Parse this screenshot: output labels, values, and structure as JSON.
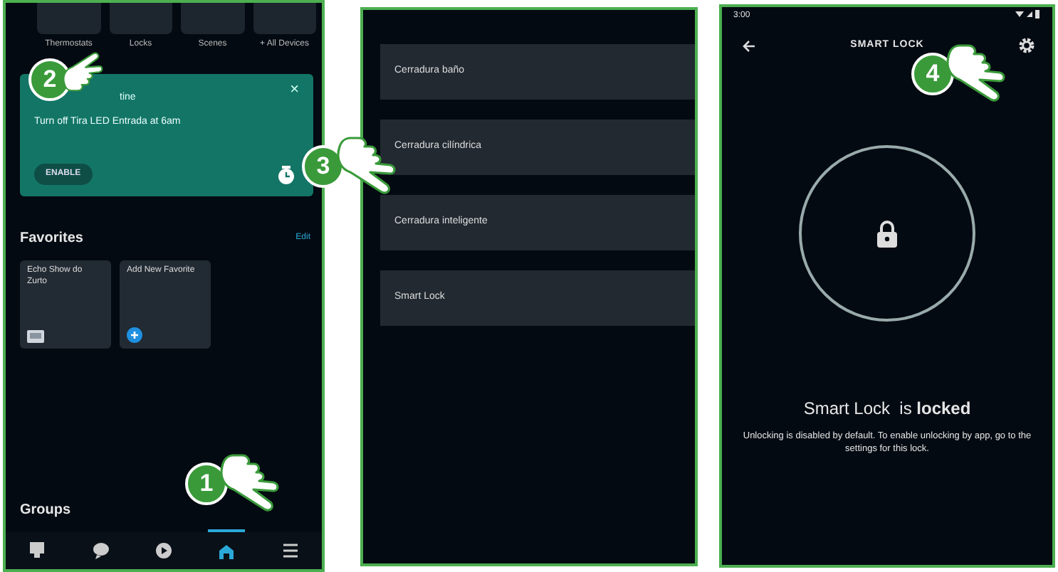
{
  "home_screen": {
    "device_tiles": [
      {
        "label": "Thermostats"
      },
      {
        "label": "Locks"
      },
      {
        "label": "Scenes"
      },
      {
        "label": "+ All Devices"
      }
    ],
    "routine_card": {
      "title": "tine",
      "text": "Turn off Tira LED Entrada at 6am",
      "button": "ENABLE",
      "close": "×"
    },
    "favorites": {
      "title": "Favorites",
      "action": "Edit",
      "items": [
        {
          "label": "Echo Show do Zurto",
          "kind": "device"
        },
        {
          "label": "Add New Favorite",
          "kind": "add"
        }
      ]
    },
    "groups_title": "Groups",
    "nav": [
      {
        "kind": "home",
        "selected": false
      },
      {
        "kind": "chat",
        "selected": false
      },
      {
        "kind": "play",
        "selected": false
      },
      {
        "kind": "devices",
        "selected": true
      },
      {
        "kind": "more",
        "selected": false
      }
    ]
  },
  "lock_list": {
    "items": [
      {
        "label": "Cerradura baño"
      },
      {
        "label": "Cerradura cilíndrica"
      },
      {
        "label": "Cerradura inteligente"
      },
      {
        "label": "Smart Lock"
      }
    ]
  },
  "lock_screen": {
    "time": "3:00",
    "title": "SMART LOCK",
    "status": "Smart Lock  is **locked**",
    "note": "Unlocking is disabled by default. To enable unlocking by app, go to the settings for this lock."
  },
  "steps": [
    {
      "number": "1"
    },
    {
      "number": "2"
    },
    {
      "number": "3"
    },
    {
      "number": "4"
    }
  ]
}
